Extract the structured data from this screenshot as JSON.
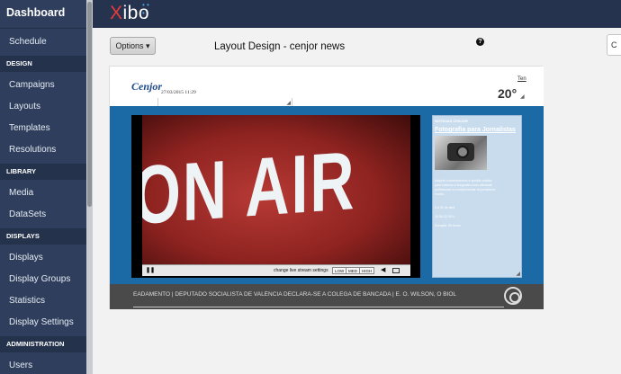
{
  "sidebar": {
    "brand": "Dashboard",
    "items": [
      {
        "label": "Schedule"
      },
      {
        "section": "DESIGN"
      },
      {
        "label": "Campaigns"
      },
      {
        "label": "Layouts"
      },
      {
        "label": "Templates"
      },
      {
        "label": "Resolutions"
      },
      {
        "section": "LIBRARY"
      },
      {
        "label": "Media"
      },
      {
        "label": "DataSets"
      },
      {
        "section": "DISPLAYS"
      },
      {
        "label": "Displays"
      },
      {
        "label": "Display Groups"
      },
      {
        "label": "Statistics"
      },
      {
        "label": "Display Settings"
      },
      {
        "section": "ADMINISTRATION"
      },
      {
        "label": "Users"
      }
    ]
  },
  "topbar": {
    "logo_x": "X",
    "logo_rest": "ibo",
    "logo_dots": "• • •"
  },
  "toolbar": {
    "options_label": "Options ▾",
    "page_title": "Layout Design - cenjor news",
    "help_glyph": "?",
    "right_button_label": "C"
  },
  "preview": {
    "header": {
      "logo_text": "Cenjor",
      "datetime": "27/03/2015 11:29",
      "weather_location": "Ten",
      "weather_temp": "20°"
    },
    "video": {
      "big_text": "ON AIR",
      "stream_label": "change live stream settings",
      "quality_options": [
        "LOW",
        "MED",
        "HIGH"
      ]
    },
    "news": {
      "source": "NOTÍCIAS CENJOR",
      "title": "Fotografia para Jornalistas",
      "body_lines": [
        "Adquirir conhecimentos e aptidão prática",
        "para elaborar a fotografia como atividade",
        "profissional ou complementar do jornalismo",
        "escrito.",
        "6 a 30 de abril,",
        "18.30-22.30 h.",
        "Duração: 50 horas"
      ]
    },
    "ticker": {
      "text": "EADAMENTO  |  DEPUTADO SOCIALISTA DE VALÊNCIA DECLARA-SE A COLEGA DE BANCADA  |  E. O. WILSON, O BIOL"
    }
  }
}
